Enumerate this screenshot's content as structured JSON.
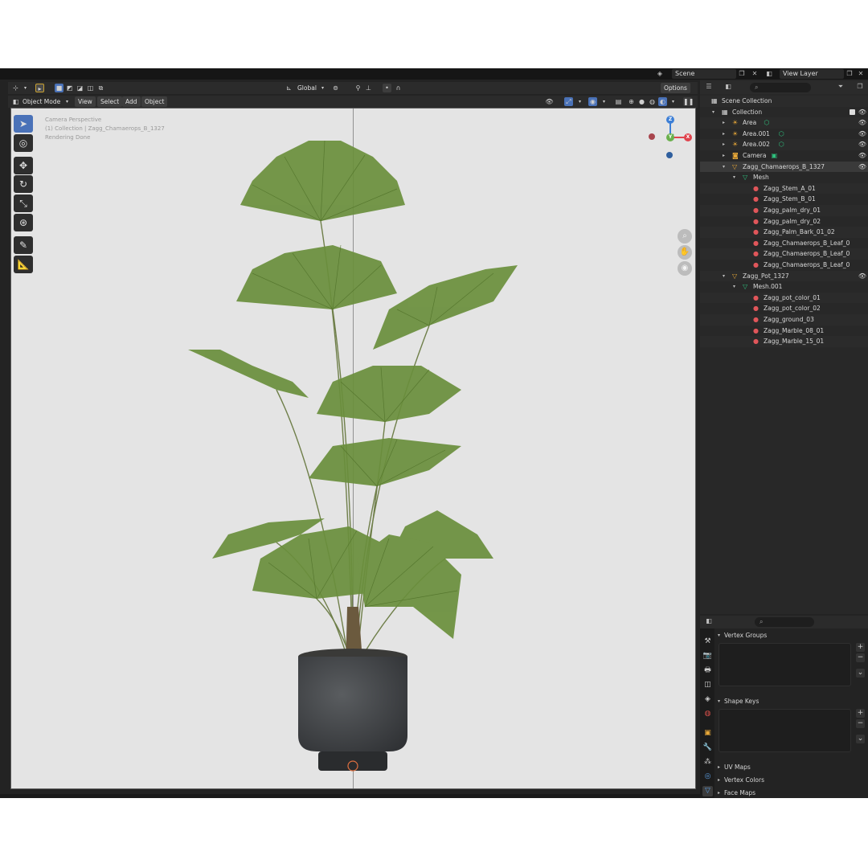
{
  "topbar": {
    "scene_label": "Scene",
    "view_layer_label": "View Layer"
  },
  "viewport_header": {
    "transform_orientation": "Global",
    "options_label": "Options"
  },
  "mode_bar": {
    "mode": "Object Mode",
    "menus": [
      "View",
      "Select",
      "Add",
      "Object"
    ]
  },
  "viewport": {
    "overlay_lines": [
      "Camera Perspective",
      "(1) Collection | Zagg_Chamaerops_B_1327",
      "Rendering Done"
    ],
    "gizmo": {
      "z": "Z",
      "x": "X",
      "y": "Y"
    }
  },
  "outliner": {
    "search_placeholder": "⌕",
    "rows": [
      {
        "label": "Scene Collection",
        "indent": 0,
        "icon": "▦",
        "icon_class": "",
        "tri": ""
      },
      {
        "label": "Collection",
        "indent": 1,
        "icon": "▦",
        "icon_class": "",
        "tri": "▾",
        "check": true,
        "eye": true
      },
      {
        "label": "Area",
        "indent": 2,
        "icon": "☀",
        "icon_class": "ic-light",
        "tri": "▸",
        "extra": "⬡",
        "eye": true
      },
      {
        "label": "Area.001",
        "indent": 2,
        "icon": "☀",
        "icon_class": "ic-light",
        "tri": "▸",
        "extra": "⬡",
        "eye": true
      },
      {
        "label": "Area.002",
        "indent": 2,
        "icon": "☀",
        "icon_class": "ic-light",
        "tri": "▸",
        "extra": "⬡",
        "eye": true
      },
      {
        "label": "Camera",
        "indent": 2,
        "icon": "◙",
        "icon_class": "ic-cam",
        "tri": "▸",
        "extra": "▣",
        "eye": true
      },
      {
        "label": "Zagg_Chamaerops_B_1327",
        "indent": 2,
        "icon": "▽",
        "icon_class": "ic-obj",
        "tri": "▾",
        "eye": true,
        "selected": true
      },
      {
        "label": "Mesh",
        "indent": 3,
        "icon": "▽",
        "icon_class": "ic-mesh",
        "tri": "▾"
      },
      {
        "label": "Zagg_Stem_A_01",
        "indent": 4,
        "icon": "●",
        "icon_class": "ic-mat",
        "tri": ""
      },
      {
        "label": "Zagg_Stem_B_01",
        "indent": 4,
        "icon": "●",
        "icon_class": "ic-mat",
        "tri": ""
      },
      {
        "label": "Zagg_palm_dry_01",
        "indent": 4,
        "icon": "●",
        "icon_class": "ic-mat",
        "tri": ""
      },
      {
        "label": "Zagg_palm_dry_02",
        "indent": 4,
        "icon": "●",
        "icon_class": "ic-mat",
        "tri": ""
      },
      {
        "label": "Zagg_Palm_Bark_01_02",
        "indent": 4,
        "icon": "●",
        "icon_class": "ic-mat",
        "tri": ""
      },
      {
        "label": "Zagg_Chamaerops_B_Leaf_0",
        "indent": 4,
        "icon": "●",
        "icon_class": "ic-mat",
        "tri": ""
      },
      {
        "label": "Zagg_Chamaerops_B_Leaf_0",
        "indent": 4,
        "icon": "●",
        "icon_class": "ic-mat",
        "tri": ""
      },
      {
        "label": "Zagg_Chamaerops_B_Leaf_0",
        "indent": 4,
        "icon": "●",
        "icon_class": "ic-mat",
        "tri": ""
      },
      {
        "label": "Zagg_Pot_1327",
        "indent": 2,
        "icon": "▽",
        "icon_class": "ic-obj",
        "tri": "▾",
        "eye": true
      },
      {
        "label": "Mesh.001",
        "indent": 3,
        "icon": "▽",
        "icon_class": "ic-mesh",
        "tri": "▾"
      },
      {
        "label": "Zagg_pot_color_01",
        "indent": 4,
        "icon": "●",
        "icon_class": "ic-mat",
        "tri": ""
      },
      {
        "label": "Zagg_pot_color_02",
        "indent": 4,
        "icon": "●",
        "icon_class": "ic-mat",
        "tri": ""
      },
      {
        "label": "Zagg_ground_03",
        "indent": 4,
        "icon": "●",
        "icon_class": "ic-mat",
        "tri": ""
      },
      {
        "label": "Zagg_Marble_08_01",
        "indent": 4,
        "icon": "●",
        "icon_class": "ic-mat",
        "tri": ""
      },
      {
        "label": "Zagg_Marble_15_01",
        "indent": 4,
        "icon": "●",
        "icon_class": "ic-mat",
        "tri": ""
      }
    ]
  },
  "properties": {
    "search_placeholder": "⌕",
    "sections": {
      "vertex_groups": "Vertex Groups",
      "shape_keys": "Shape Keys",
      "uv_maps": "UV Maps",
      "vertex_colors": "Vertex Colors",
      "face_maps": "Face Maps"
    }
  },
  "colors": {
    "accent": "#4a72b8",
    "axis_x": "#e0434d",
    "axis_y": "#6ab04c",
    "axis_z": "#3d7fd6"
  }
}
